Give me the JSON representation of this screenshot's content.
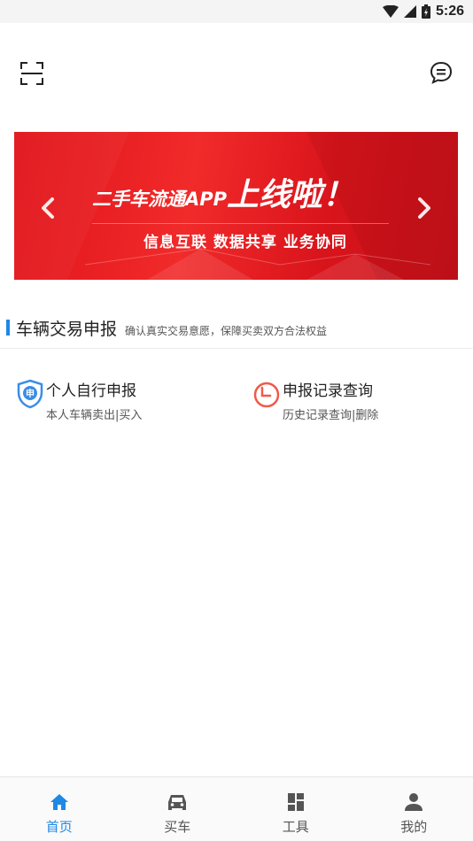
{
  "status_bar": {
    "time": "5:26"
  },
  "header": {
    "left_icon": "scan-icon",
    "right_icon": "message-icon"
  },
  "banner": {
    "title_small": "二手车流通APP",
    "title_big": "上线啦！",
    "subtitle": "信息互联 数据共享 业务协同",
    "colors": {
      "background": "#e0141b",
      "text": "#ffffff"
    }
  },
  "section": {
    "title": "车辆交易申报",
    "description": "确认真实交易意愿，保障买卖双方合法权益",
    "accent_color": "#1e88e5"
  },
  "features": [
    {
      "icon": "shield-shen-icon",
      "title": "个人自行申报",
      "subtitle": "本人车辆卖出|买入"
    },
    {
      "icon": "clock-icon",
      "title": "申报记录查询",
      "subtitle": "历史记录查询|删除"
    }
  ],
  "bottom_nav": {
    "items": [
      {
        "icon": "home-icon",
        "label": "首页",
        "active": true
      },
      {
        "icon": "car-icon",
        "label": "买车",
        "active": false
      },
      {
        "icon": "grid-icon",
        "label": "工具",
        "active": false
      },
      {
        "icon": "user-icon",
        "label": "我的",
        "active": false
      }
    ],
    "active_color": "#1e88e5"
  }
}
